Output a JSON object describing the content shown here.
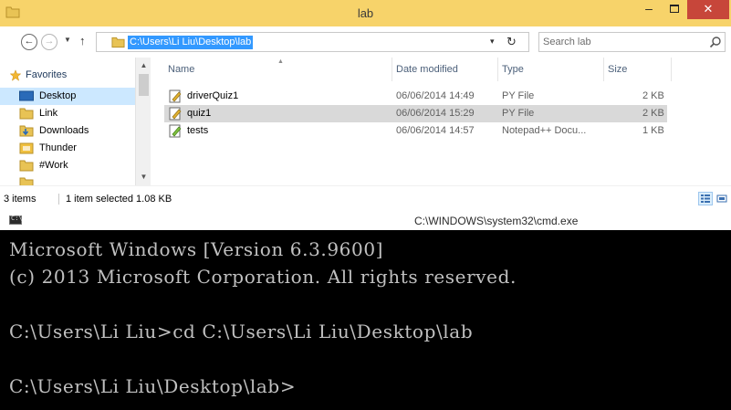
{
  "explorer": {
    "title": "lab",
    "window_controls": {
      "minimize": "–",
      "close": "✕"
    },
    "address": {
      "path": "C:\\Users\\Li Liu\\Desktop\\lab",
      "dropdown": "▾",
      "refresh": "↻"
    },
    "nav_buttons": {
      "back": "←",
      "forward": "→",
      "recent": "▼",
      "up": "↑"
    },
    "search": {
      "placeholder": "Search lab"
    },
    "nav_pane": {
      "favorites_label": "Favorites",
      "items": [
        {
          "label": "Desktop",
          "icon": "desktop-icon"
        },
        {
          "label": "Link",
          "icon": "folder-icon"
        },
        {
          "label": "Downloads",
          "icon": "downloads-folder-icon"
        },
        {
          "label": "Thunder",
          "icon": "thunder-icon"
        },
        {
          "label": "#Work",
          "icon": "folder-icon"
        }
      ],
      "selected_index": 0
    },
    "columns": {
      "name": "Name",
      "date": "Date modified",
      "type": "Type",
      "size": "Size"
    },
    "files": [
      {
        "name": "driverQuiz1",
        "date": "06/06/2014 14:49",
        "type": "PY File",
        "size": "2 KB",
        "icon": "py-file-icon"
      },
      {
        "name": "quiz1",
        "date": "06/06/2014 15:29",
        "type": "PY File",
        "size": "2 KB",
        "icon": "py-file-icon"
      },
      {
        "name": "tests",
        "date": "06/06/2014 14:57",
        "type": "Notepad++ Docu...",
        "size": "1 KB",
        "icon": "notepad-file-icon"
      }
    ],
    "selected_file_index": 1,
    "status": {
      "items": "3 items",
      "selection": "1 item selected  1.08 KB"
    }
  },
  "cmd": {
    "title": "C:\\WINDOWS\\system32\\cmd.exe",
    "icon_text": "C:\\",
    "lines": [
      "Microsoft Windows [Version 6.3.9600]",
      "(c) 2013 Microsoft Corporation. All rights reserved.",
      "",
      "C:\\Users\\Li Liu>cd C:\\Users\\Li Liu\\Desktop\\lab",
      "",
      "C:\\Users\\Li Liu\\Desktop\\lab>"
    ]
  },
  "colors": {
    "titlebar": "#f7d36a",
    "close_button": "#c7463a",
    "address_highlight": "#3399ff",
    "nav_selected": "#cce8ff",
    "row_selected": "#d9d9d9",
    "console_bg": "#000000",
    "console_text": "#c0c0c0"
  }
}
